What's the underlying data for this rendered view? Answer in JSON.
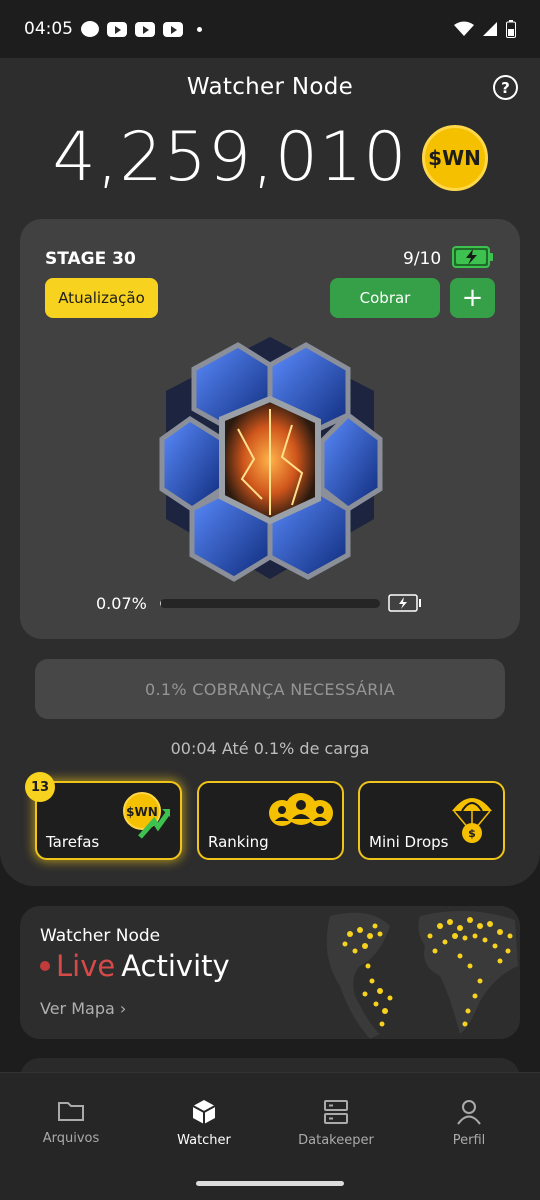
{
  "status_bar": {
    "time": "04:05"
  },
  "header": {
    "title": "Watcher Node",
    "help_icon": "question-circle-icon"
  },
  "balance": {
    "amount": "4,259,010",
    "currency": "$WN"
  },
  "stage": {
    "label": "STAGE 30",
    "count": "9/10",
    "update_label": "Atualização",
    "collect_label": "Cobrar",
    "add_label": "+",
    "progress_text": "0.07%",
    "progress_value": 0.07
  },
  "charge_button_label": "0.1% COBRANÇA NECESSÁRIA",
  "timer_text": "00:04 Até 0.1% de carga",
  "features": {
    "tasks": {
      "label": "Tarefas",
      "badge": "13",
      "coin_text": "$WN"
    },
    "ranking": {
      "label": "Ranking"
    },
    "minidrops": {
      "label": "Mini Drops",
      "coin_text": "$"
    }
  },
  "live": {
    "title": "Watcher Node",
    "live_word": "Live",
    "activity_word": "Activity",
    "map_link": "Ver Mapa"
  },
  "nav": [
    {
      "label": "Arquivos",
      "icon": "folder-icon"
    },
    {
      "label": "Watcher",
      "icon": "cube-icon"
    },
    {
      "label": "Datakeeper",
      "icon": "server-icon"
    },
    {
      "label": "Perfil",
      "icon": "user-icon"
    }
  ],
  "colors": {
    "accent_yellow": "#f7d21e",
    "accent_green": "#35a047",
    "live_red": "#d84a4a",
    "background": "#1d1d1d",
    "panel": "#2d2d2d",
    "card": "#414141"
  }
}
